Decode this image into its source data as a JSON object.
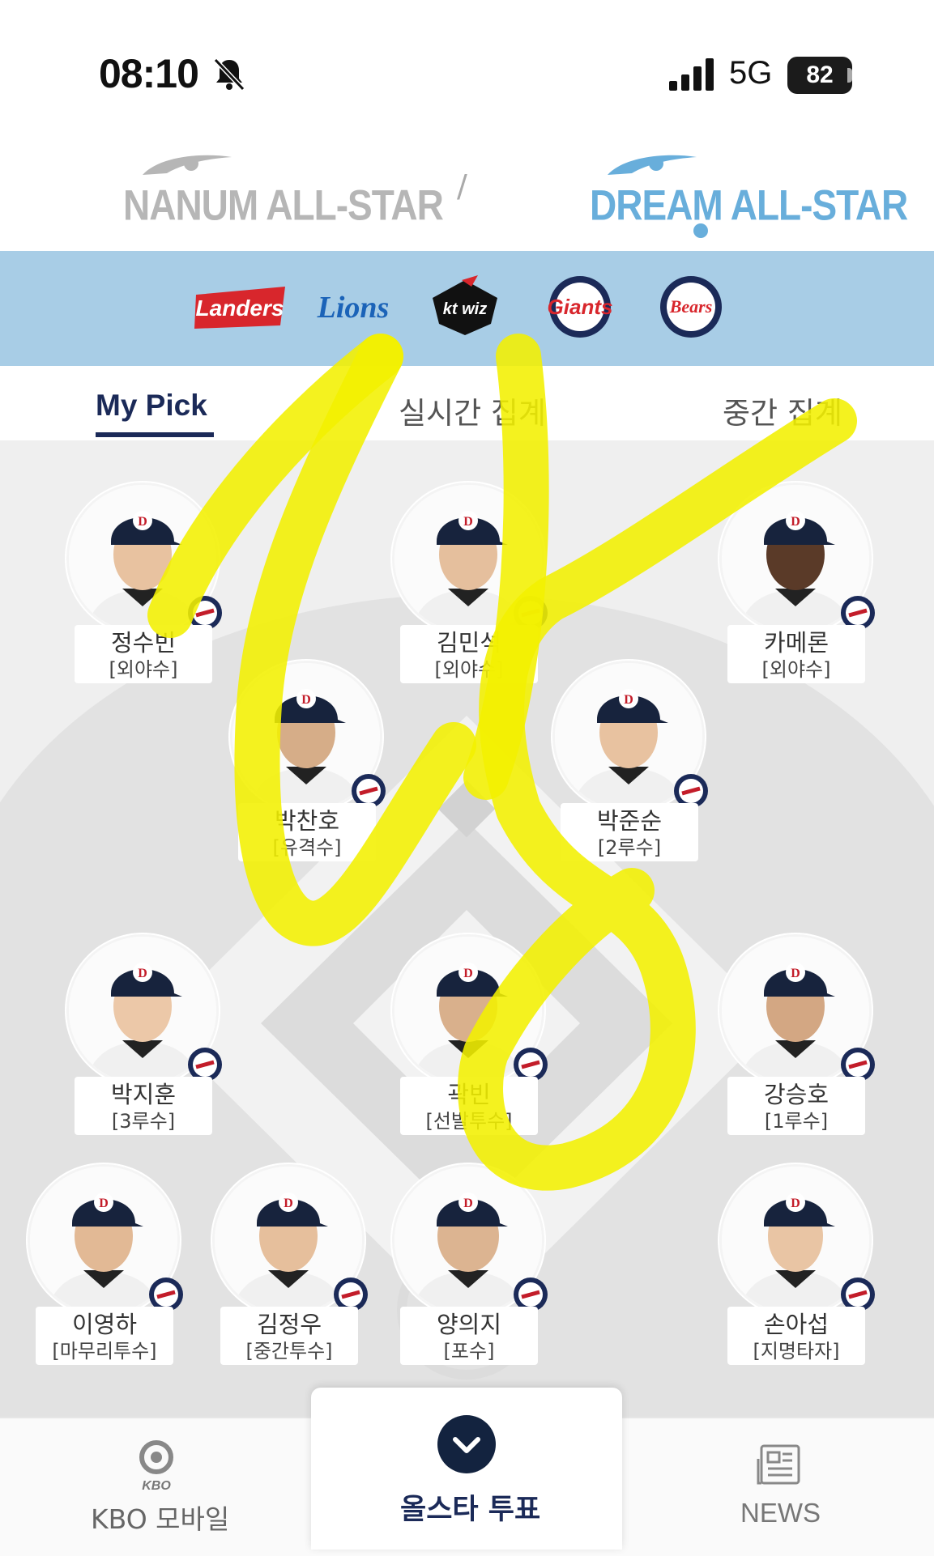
{
  "status_bar": {
    "time": "08:10",
    "network": "5G",
    "battery": "82"
  },
  "allstar_tabs": {
    "left": "NANUM ALL-STAR",
    "right": "DREAM ALL-STAR",
    "separator": "/"
  },
  "teams": [
    {
      "name": "Landers",
      "color": "#d8262c"
    },
    {
      "name": "Lions",
      "color": "#1b63b8"
    },
    {
      "name": "kt wiz",
      "color": "#111111"
    },
    {
      "name": "Giants",
      "color": "#d8262c"
    },
    {
      "name": "Bears",
      "color": "#1b2a58"
    }
  ],
  "view_tabs": {
    "my_pick": "My Pick",
    "realtime": "실시간 집계",
    "mid": "중간 집계"
  },
  "players": [
    {
      "name": "정수빈",
      "position": "[외야수]"
    },
    {
      "name": "김민석",
      "position": "[외야수]"
    },
    {
      "name": "카메론",
      "position": "[외야수]"
    },
    {
      "name": "박찬호",
      "position": "[유격수]"
    },
    {
      "name": "박준순",
      "position": "[2루수]"
    },
    {
      "name": "박지훈",
      "position": "[3루수]"
    },
    {
      "name": "곽빈",
      "position": "[선발투수]"
    },
    {
      "name": "강승호",
      "position": "[1루수]"
    },
    {
      "name": "이영하",
      "position": "[마무리투수]"
    },
    {
      "name": "김정우",
      "position": "[중간투수]"
    },
    {
      "name": "양의지",
      "position": "[포수]"
    },
    {
      "name": "손아섭",
      "position": "[지명타자]"
    }
  ],
  "bottom_nav": {
    "kbo": "KBO 모바일",
    "kbo_icon_text": "KBO",
    "vote": "올스타 투표",
    "news": "NEWS"
  },
  "colors": {
    "accent": "#1b2a58",
    "team_bar": "#a8cde6",
    "dream": "#68aedb",
    "highlighter": "#f3f000"
  },
  "icons": {
    "mute": "bell-slash-icon",
    "signal": "signal-bars-icon",
    "vote": "chevron-down-icon",
    "news": "newspaper-icon",
    "kbo": "kbo-logo-icon"
  }
}
